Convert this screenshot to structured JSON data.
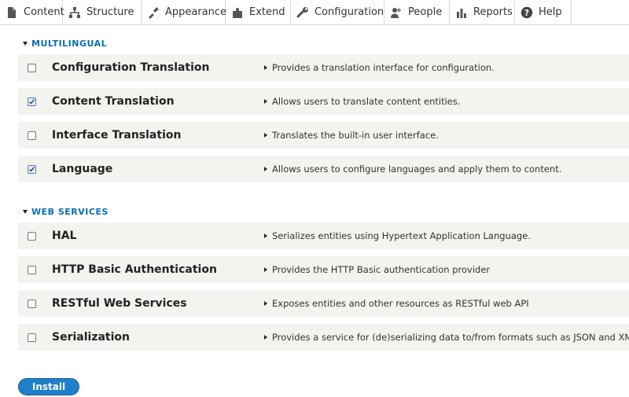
{
  "toolbar": {
    "items": [
      {
        "label": "Content",
        "icon": "content-icon"
      },
      {
        "label": "Structure",
        "icon": "structure-icon"
      },
      {
        "label": "Appearance",
        "icon": "appearance-icon"
      },
      {
        "label": "Extend",
        "icon": "extend-icon"
      },
      {
        "label": "Configuration",
        "icon": "configuration-icon"
      },
      {
        "label": "People",
        "icon": "people-icon"
      },
      {
        "label": "Reports",
        "icon": "reports-icon"
      },
      {
        "label": "Help",
        "icon": "help-icon"
      }
    ]
  },
  "sections": [
    {
      "title": "MULTILINGUAL",
      "modules": [
        {
          "name": "Configuration Translation",
          "description": "Provides a translation interface for configuration.",
          "checked": false
        },
        {
          "name": "Content Translation",
          "description": "Allows users to translate content entities.",
          "checked": true
        },
        {
          "name": "Interface Translation",
          "description": "Translates the built-in user interface.",
          "checked": false
        },
        {
          "name": "Language",
          "description": "Allows users to configure languages and apply them to content.",
          "checked": true
        }
      ]
    },
    {
      "title": "WEB SERVICES",
      "modules": [
        {
          "name": "HAL",
          "description": "Serializes entities using Hypertext Application Language.",
          "checked": false
        },
        {
          "name": "HTTP Basic Authentication",
          "description": "Provides the HTTP Basic authentication provider",
          "checked": false
        },
        {
          "name": "RESTful Web Services",
          "description": "Exposes entities and other resources as RESTful web API",
          "checked": false
        },
        {
          "name": "Serialization",
          "description": "Provides a service for (de)serializing data to/from formats such as JSON and XML",
          "checked": false
        }
      ]
    }
  ],
  "actions": {
    "install_label": "Install"
  },
  "colors": {
    "link": "#0a6eb4",
    "row_bg": "#f3f3ef",
    "button": "#1f7fc9"
  }
}
